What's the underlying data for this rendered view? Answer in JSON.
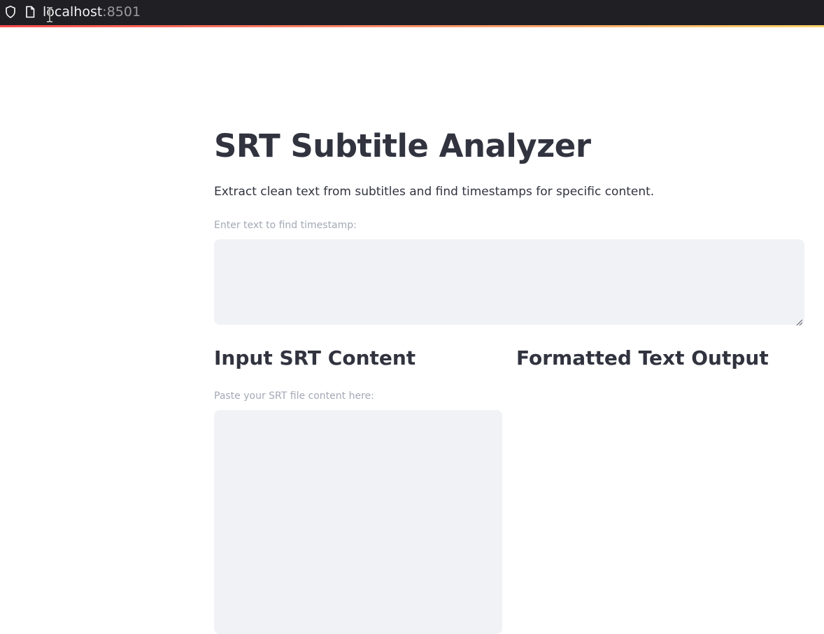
{
  "browser": {
    "url_host": "localhost",
    "url_port": ":8501",
    "icons": [
      "shield-icon",
      "page-icon",
      "text-cursor-icon"
    ]
  },
  "app": {
    "title": "SRT Subtitle Analyzer",
    "subtitle": "Extract clean text from subtitles and find timestamps for specific content.",
    "search": {
      "label": "Enter text to find timestamp:",
      "value": ""
    },
    "input_section": {
      "heading": "Input SRT Content",
      "label": "Paste your SRT file content here:",
      "value": ""
    },
    "output_section": {
      "heading": "Formatted Text Output"
    }
  },
  "colors": {
    "text": "#31333f",
    "label": "#a3a8b4",
    "input_bg": "#f0f2f6",
    "accent_start": "#ff4b4b",
    "accent_end": "#ffd46b",
    "browser_bar": "#1f1f24"
  }
}
